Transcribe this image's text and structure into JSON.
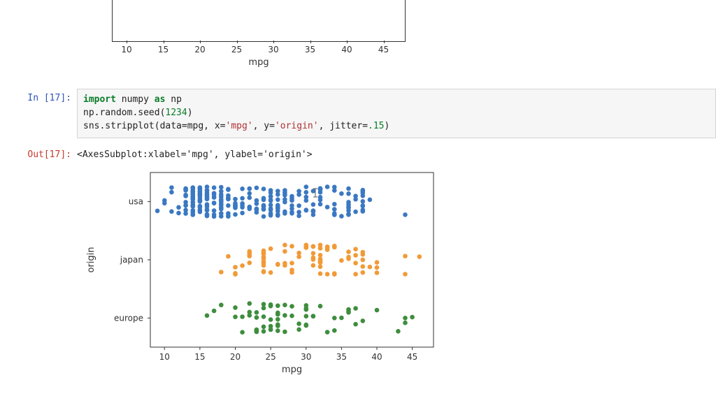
{
  "prev_plot": {
    "xlabel": "mpg",
    "xticks": [
      10,
      15,
      20,
      25,
      30,
      35,
      40,
      45
    ]
  },
  "cell_in": {
    "prompt": "In [17]:",
    "tokens": [
      {
        "t": "import",
        "c": "kw"
      },
      {
        "t": " numpy "
      },
      {
        "t": "as",
        "c": "kw"
      },
      {
        "t": " np\n"
      },
      {
        "t": "np.random.seed("
      },
      {
        "t": "1234",
        "c": "num"
      },
      {
        "t": ")\n"
      },
      {
        "t": "sns.stripplot(data=mpg, x="
      },
      {
        "t": "'mpg'",
        "c": "str"
      },
      {
        "t": ", y="
      },
      {
        "t": "'origin'",
        "c": "str"
      },
      {
        "t": ", jitter="
      },
      {
        "t": ".15",
        "c": "num"
      },
      {
        "t": ")"
      }
    ]
  },
  "cell_out": {
    "prompt": "Out[17]:",
    "text": "<AxesSubplot:xlabel='mpg', ylabel='origin'>"
  },
  "plot": {
    "xlabel": "mpg",
    "ylabel": "origin",
    "yticks": [
      "usa",
      "japan",
      "europe"
    ],
    "xticks": [
      10,
      15,
      20,
      25,
      30,
      35,
      40,
      45
    ],
    "colors": {
      "usa": "#3b78c2",
      "japan": "#f19a37",
      "europe": "#3e8d3e"
    }
  },
  "chart_data": {
    "type": "strip",
    "xlabel": "mpg",
    "ylabel": "origin",
    "ylim_categories": [
      "usa",
      "japan",
      "europe"
    ],
    "xlim": [
      8,
      48
    ],
    "x_axis_ticks": [
      10,
      15,
      20,
      25,
      30,
      35,
      40,
      45
    ],
    "jitter": 0.15,
    "series": [
      {
        "name": "usa",
        "color": "#3b78c2",
        "x": [
          18,
          15,
          18,
          16,
          17,
          15,
          14,
          14,
          14,
          15,
          15,
          14,
          15,
          14,
          24,
          22,
          18,
          21,
          27,
          26,
          25,
          24,
          25,
          26,
          21,
          10,
          10,
          11,
          9,
          27,
          28,
          25,
          19,
          16,
          17,
          19,
          18,
          14,
          14,
          14,
          14,
          12,
          13,
          13,
          18,
          22,
          19,
          18,
          23,
          28,
          30,
          30,
          31,
          35,
          27,
          26,
          24,
          25,
          23,
          20,
          21,
          13,
          14,
          15,
          14,
          17,
          11,
          13,
          12,
          13,
          19,
          15,
          13,
          13,
          14,
          18,
          22,
          21,
          26,
          15,
          16,
          29,
          24,
          20,
          19,
          15,
          24,
          20,
          11,
          20,
          19,
          15,
          31,
          36,
          25,
          33,
          17,
          17,
          15,
          15,
          16,
          15,
          16,
          14,
          17,
          16,
          15,
          18,
          21,
          20,
          13,
          29,
          23,
          23,
          22,
          25,
          33,
          28,
          25,
          25,
          26,
          27,
          18,
          16,
          16,
          16,
          13,
          14,
          14,
          14,
          29,
          26,
          26,
          31,
          32,
          28,
          24,
          26,
          24,
          26,
          31,
          19,
          18,
          15,
          15,
          16,
          15,
          16,
          14,
          17,
          16,
          15,
          18,
          21,
          20,
          13,
          23,
          20,
          23,
          18,
          19,
          25,
          26,
          19,
          19,
          31,
          28,
          17,
          17,
          20,
          18,
          15,
          15,
          16,
          16,
          16,
          16,
          18,
          16,
          13,
          14,
          14,
          14,
          29,
          24,
          23,
          36,
          37,
          31,
          38,
          36,
          36,
          36,
          34,
          38,
          32,
          38,
          25,
          38,
          26,
          22,
          32,
          28,
          17,
          34,
          30,
          30,
          28,
          29,
          27,
          24,
          36,
          37,
          31,
          38,
          36,
          36,
          36,
          34,
          38,
          32,
          38,
          25,
          38,
          26,
          22,
          32,
          28,
          27,
          22,
          18,
          30,
          39,
          35,
          32,
          37,
          27,
          27,
          34,
          34,
          36,
          32,
          44,
          38,
          32,
          34,
          20,
          30
        ]
      },
      {
        "name": "japan",
        "color": "#f19a37",
        "x": [
          24,
          27,
          25,
          24,
          19,
          28,
          31,
          35,
          24,
          24,
          18,
          27,
          20,
          22,
          31,
          32,
          31,
          32,
          24,
          26,
          24,
          33,
          32,
          28,
          20,
          22,
          22,
          24,
          22,
          29,
          24,
          29,
          33,
          20,
          31,
          32,
          21,
          33,
          34,
          24,
          32,
          27,
          33,
          28,
          30,
          36,
          40,
          44,
          24,
          37,
          24,
          36,
          38,
          34,
          30,
          40,
          46,
          32,
          37,
          27,
          32,
          34,
          33,
          37,
          31,
          38,
          32,
          38,
          25,
          38,
          26,
          22,
          32,
          28,
          39,
          36,
          31,
          30,
          34,
          44,
          38,
          32,
          40,
          37
        ]
      },
      {
        "name": "europe",
        "color": "#3e8d3e",
        "x": [
          25,
          25,
          26,
          24,
          25,
          26,
          21,
          26,
          30,
          22,
          28,
          24,
          24,
          22,
          18,
          29,
          26,
          28,
          23,
          24,
          25,
          23,
          30,
          30,
          31,
          20,
          17,
          21,
          23,
          27,
          29,
          26,
          16,
          35,
          30,
          26,
          20,
          31,
          27,
          44,
          32,
          43,
          34,
          25,
          23,
          23,
          27,
          36,
          44,
          26,
          40,
          38,
          30,
          37,
          36,
          34,
          30,
          22,
          25,
          23,
          37,
          36,
          24,
          45,
          26,
          36,
          33
        ]
      }
    ]
  }
}
